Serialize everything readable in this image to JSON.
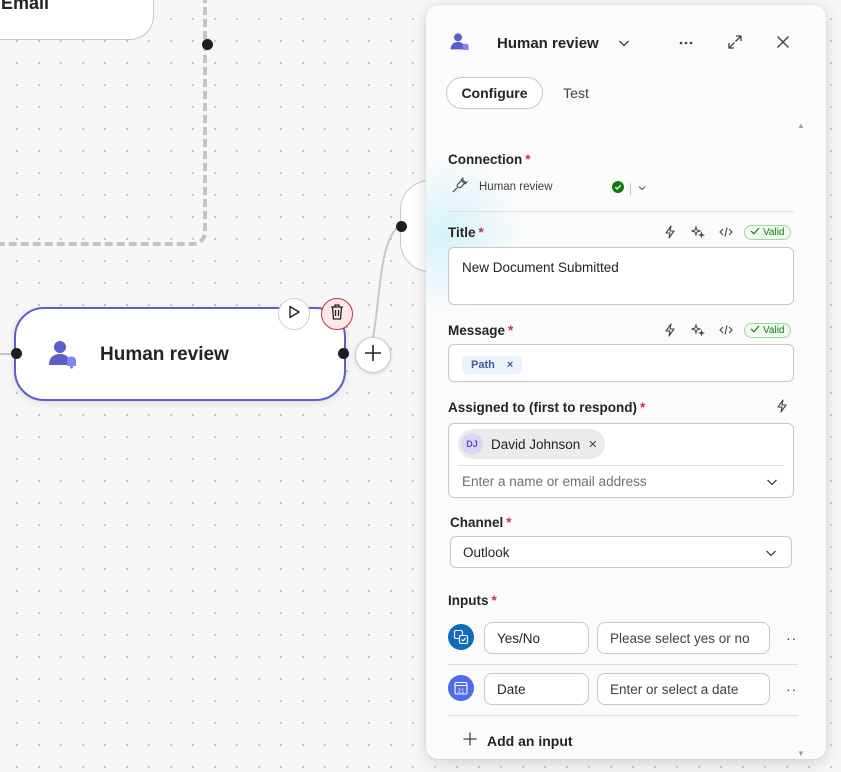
{
  "canvas": {
    "partial_node_label": "Email",
    "node": {
      "label": "Human review"
    }
  },
  "panel": {
    "title": "Human review",
    "tabs": [
      {
        "label": "Configure",
        "active": true
      },
      {
        "label": "Test",
        "active": false
      }
    ],
    "connection": {
      "label": "Connection",
      "required_mark": "*",
      "value": "Human review",
      "status_color": "#107c10"
    },
    "title_field": {
      "label": "Title",
      "required_mark": "*",
      "badge": "Valid",
      "value": "New Document Submitted"
    },
    "message_field": {
      "label": "Message",
      "required_mark": "*",
      "badge": "Valid",
      "token": "Path",
      "token_remove": "×"
    },
    "assigned_field": {
      "label": "Assigned to (first to respond)",
      "required_mark": "*",
      "person": {
        "initials": "DJ",
        "name": "David Johnson",
        "remove": "×"
      },
      "placeholder": "Enter a name or email address"
    },
    "channel_field": {
      "label": "Channel",
      "required_mark": "*",
      "value": "Outlook"
    },
    "inputs": {
      "label": "Inputs",
      "required_mark": "*",
      "rows": [
        {
          "type_icon": "yes-no-icon",
          "icon_color": "#0f6cbd",
          "name": "Yes/No",
          "description": "Please select yes or no",
          "more": "··"
        },
        {
          "type_icon": "calendar-icon",
          "icon_color": "#4f6bed",
          "name": "Date",
          "description": "Enter or select a date",
          "more": "··"
        }
      ],
      "add_label": "Add an input"
    }
  },
  "colors": {
    "accent": "#5b5fc7",
    "valid": "#107c10",
    "required": "#c4314b"
  }
}
